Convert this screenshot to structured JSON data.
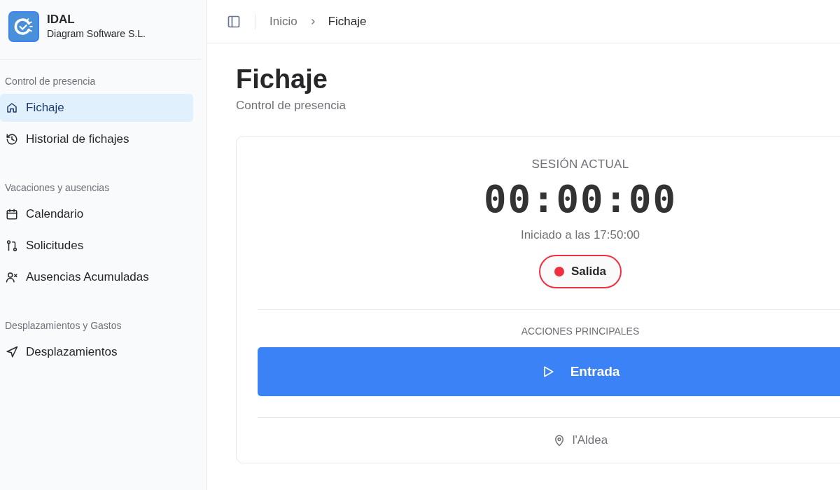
{
  "brand": {
    "name": "IDAL",
    "company": "Diagram Software S.L."
  },
  "sidebar": {
    "groups": [
      {
        "label": "Control de presencia",
        "items": [
          {
            "label": "Fichaje",
            "kind": "home",
            "selected": true
          },
          {
            "label": "Historial de fichajes",
            "kind": "history",
            "selected": false
          }
        ]
      },
      {
        "label": "Vacaciones y ausencias",
        "items": [
          {
            "label": "Calendario",
            "kind": "calendar",
            "selected": false
          },
          {
            "label": "Solicitudes",
            "kind": "requests",
            "selected": false
          },
          {
            "label": "Ausencias Acumuladas",
            "kind": "absences",
            "selected": false
          }
        ]
      },
      {
        "label": "Desplazamientos y Gastos",
        "items": [
          {
            "label": "Desplazamientos",
            "kind": "trips",
            "selected": false
          }
        ]
      }
    ]
  },
  "breadcrumb": [
    {
      "label": "Inicio",
      "current": false
    },
    {
      "label": "Fichaje",
      "current": true
    }
  ],
  "page": {
    "title": "Fichaje",
    "subtitle": "Control de presencia"
  },
  "session": {
    "label": "SESIÓN ACTUAL",
    "timer": "00:00:00",
    "started": "Iniciado a las 17:50:00",
    "status": {
      "label": "Salida",
      "color": "#f0303f"
    }
  },
  "actions": {
    "label": "ACCIONES PRINCIPALES",
    "primary": {
      "label": "Entrada"
    }
  },
  "location": "l'Aldea"
}
